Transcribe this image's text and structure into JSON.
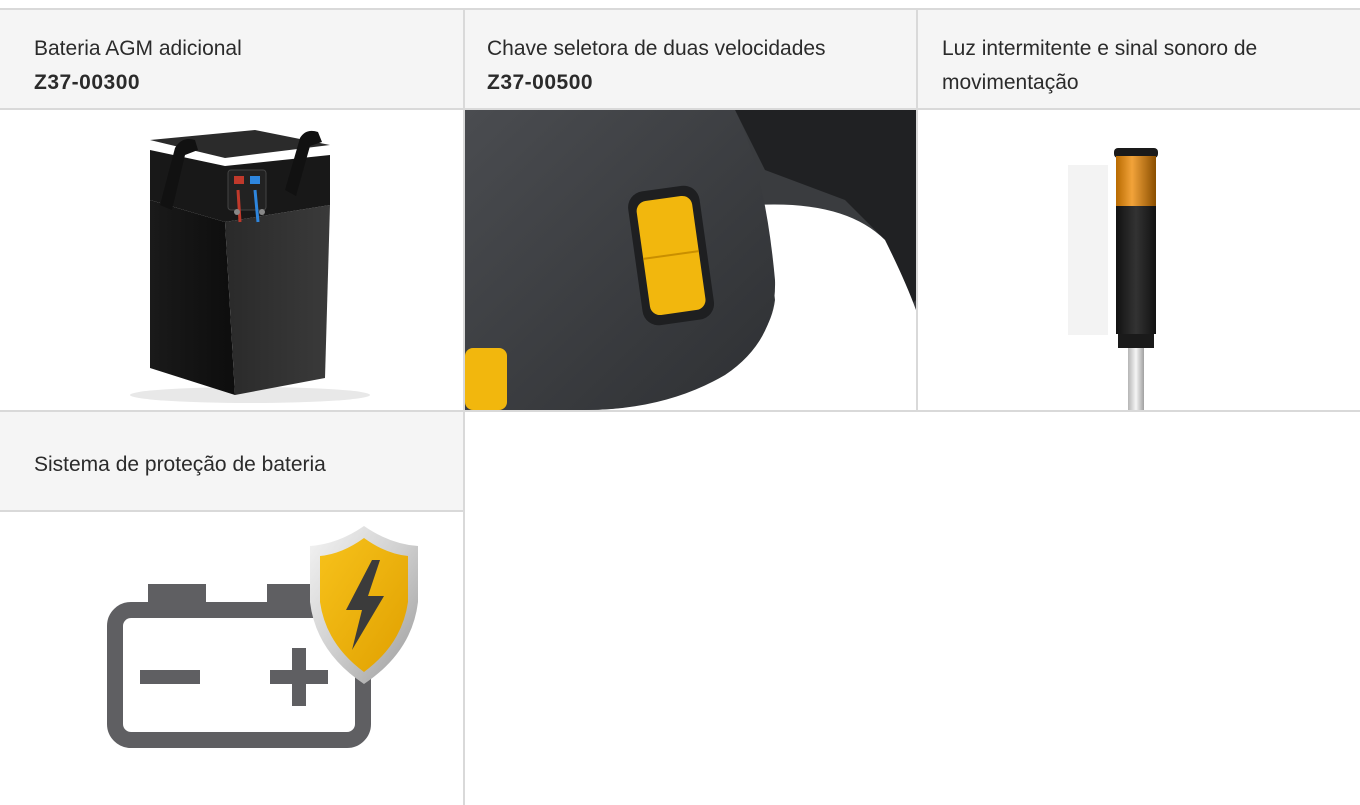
{
  "products": [
    {
      "name": "Bateria AGM adicional",
      "code": "Z37-00300",
      "image_icon": "agm-battery-box"
    },
    {
      "name": "Chave seletora de duas velocidades",
      "code": "Z37-00500",
      "image_icon": "two-speed-rocker-switch"
    },
    {
      "name": "Luz intermitente e sinal sonoro de movimentação",
      "code": "",
      "image_icon": "flashing-beacon-light"
    },
    {
      "name": "Sistema de proteção de bateria",
      "code": "",
      "image_icon": "battery-protection-shield"
    }
  ],
  "colors": {
    "header_bg": "#f5f5f5",
    "grid_line": "#d9d9d9",
    "accent_yellow": "#f2b70d",
    "icon_gray": "#5f5f62"
  }
}
